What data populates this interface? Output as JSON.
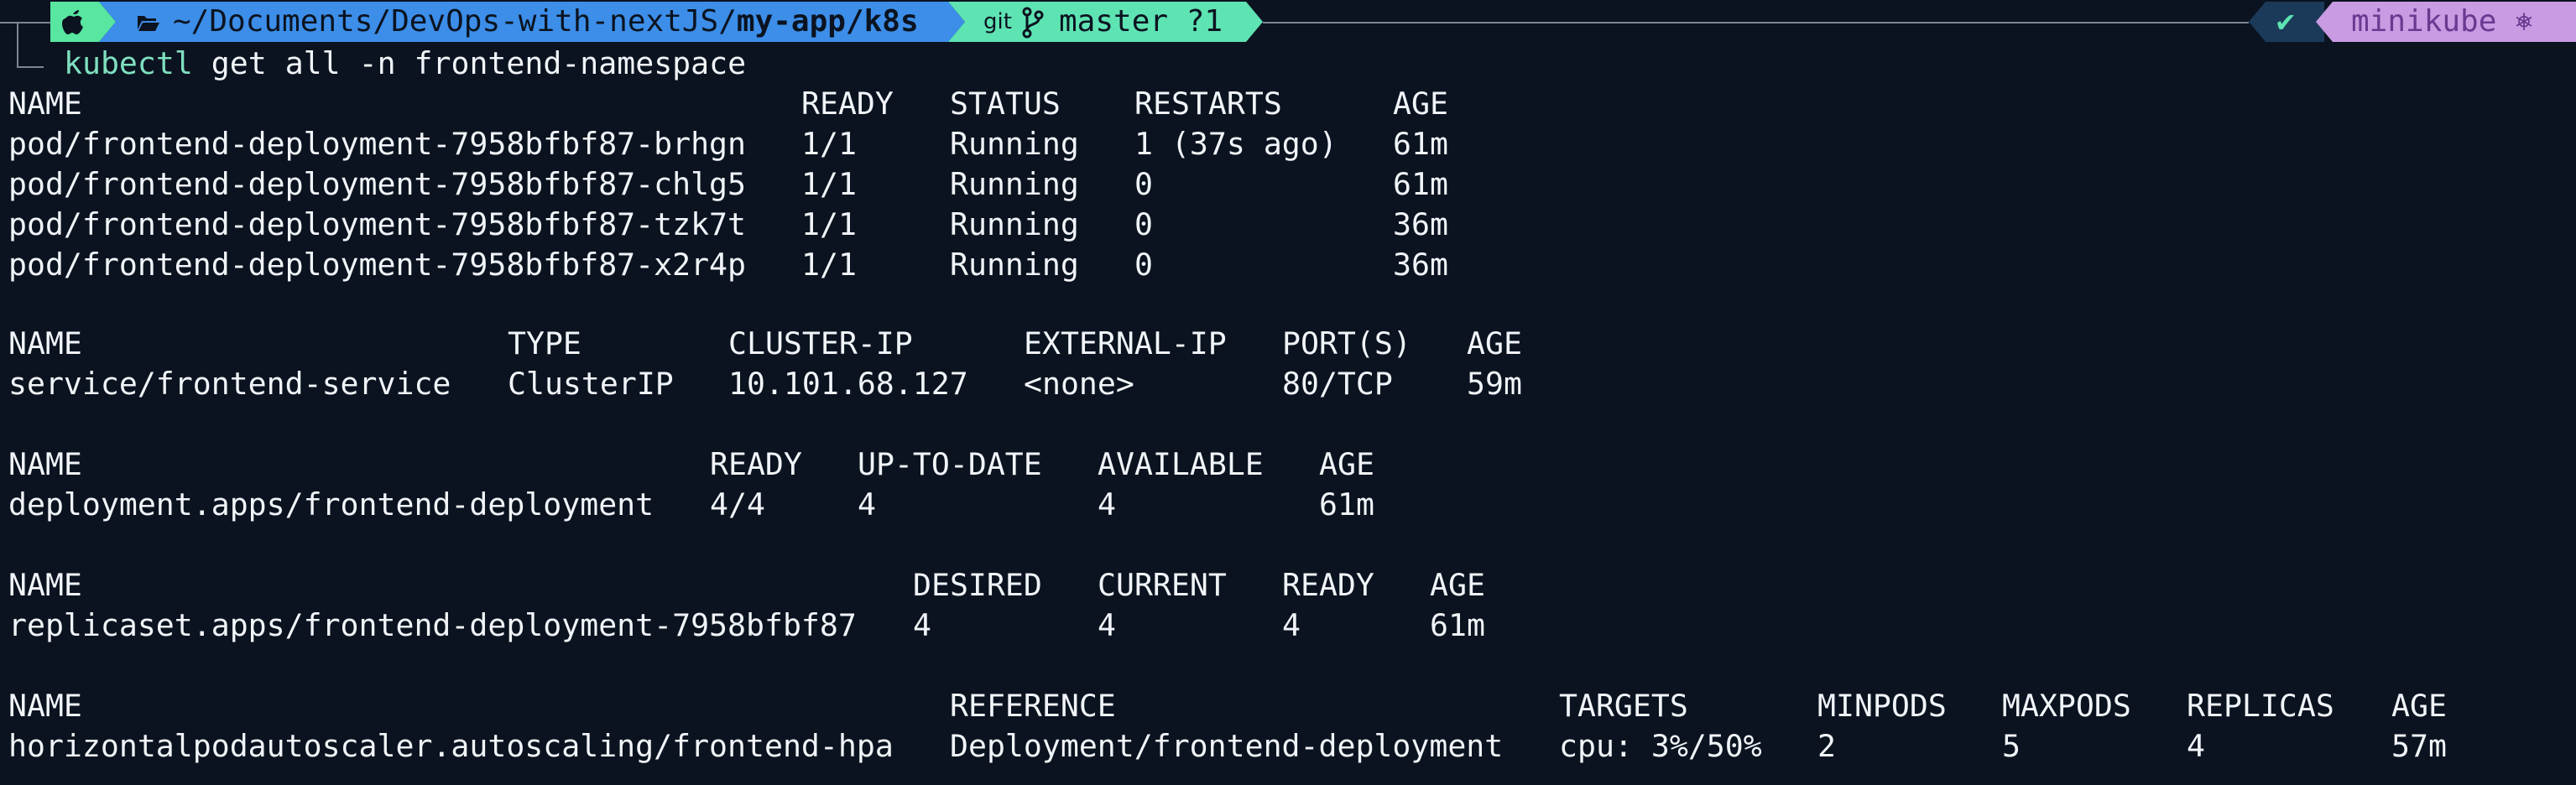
{
  "prompt": {
    "os_icon": "apple-icon",
    "folder_icon": "folder-icon",
    "path_prefix": "~/Documents/DevOps-with-nextJS/",
    "path_bold": "my-app/k8s",
    "git_icon": "git-icon",
    "branch_icon": "branch-icon",
    "branch": "master ?1",
    "check": "✔",
    "context": "minikube ⎈",
    "colors": {
      "os_bg": "#58e6a0",
      "path_bg": "#3c8ee8",
      "git_bg": "#5ee3b2",
      "status_bg": "#1b3a59",
      "context_bg": "#c89be2"
    }
  },
  "command": {
    "name": "kubectl",
    "args": " get all -n frontend-namespace"
  },
  "pods": {
    "headers": [
      "NAME",
      "READY",
      "STATUS",
      "RESTARTS",
      "AGE"
    ],
    "rows": [
      [
        "pod/frontend-deployment-7958bfbf87-brhgn",
        "1/1",
        "Running",
        "1 (37s ago)",
        "61m"
      ],
      [
        "pod/frontend-deployment-7958bfbf87-chlg5",
        "1/1",
        "Running",
        "0",
        "61m"
      ],
      [
        "pod/frontend-deployment-7958bfbf87-tzk7t",
        "1/1",
        "Running",
        "0",
        "36m"
      ],
      [
        "pod/frontend-deployment-7958bfbf87-x2r4p",
        "1/1",
        "Running",
        "0",
        "36m"
      ]
    ]
  },
  "services": {
    "headers": [
      "NAME",
      "TYPE",
      "CLUSTER-IP",
      "EXTERNAL-IP",
      "PORT(S)",
      "AGE"
    ],
    "rows": [
      [
        "service/frontend-service",
        "ClusterIP",
        "10.101.68.127",
        "<none>",
        "80/TCP",
        "59m"
      ]
    ]
  },
  "deployments": {
    "headers": [
      "NAME",
      "READY",
      "UP-TO-DATE",
      "AVAILABLE",
      "AGE"
    ],
    "rows": [
      [
        "deployment.apps/frontend-deployment",
        "4/4",
        "4",
        "4",
        "61m"
      ]
    ]
  },
  "replicasets": {
    "headers": [
      "NAME",
      "DESIRED",
      "CURRENT",
      "READY",
      "AGE"
    ],
    "rows": [
      [
        "replicaset.apps/frontend-deployment-7958bfbf87",
        "4",
        "4",
        "4",
        "61m"
      ]
    ]
  },
  "hpas": {
    "headers": [
      "NAME",
      "REFERENCE",
      "TARGETS",
      "MINPODS",
      "MAXPODS",
      "REPLICAS",
      "AGE"
    ],
    "rows": [
      [
        "horizontalpodautoscaler.autoscaling/frontend-hpa",
        "Deployment/frontend-deployment",
        "cpu: 3%/50%",
        "2",
        "5",
        "4",
        "57m"
      ]
    ]
  }
}
